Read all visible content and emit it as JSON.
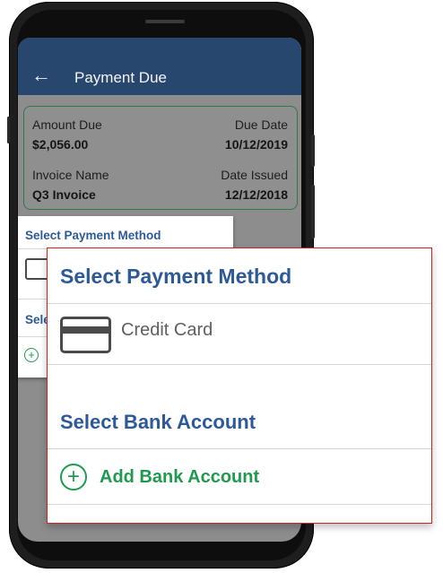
{
  "header": {
    "title": "Payment Due",
    "back_icon": "←"
  },
  "summary": {
    "amount_due_label": "Amount Due",
    "amount_due_value": "$2,056.00",
    "due_date_label": "Due Date",
    "due_date_value": "10/12/2019",
    "invoice_name_label": "Invoice Name",
    "invoice_name_value": "Q3 Invoice",
    "date_issued_label": "Date Issued",
    "date_issued_value": "12/12/2018"
  },
  "sheet": {
    "payment_method_title": "Select Payment Method",
    "bank_account_title_partial": "Sele",
    "plus_glyph": "+"
  },
  "zoom_panel": {
    "payment_method_title": "Select Payment Method",
    "credit_card_label": "Credit Card",
    "bank_account_title": "Select Bank Account",
    "add_bank_account_label": "Add Bank Account",
    "plus_glyph": "+"
  },
  "colors": {
    "app_bar": "#28476e",
    "section_title": "#2d5a97",
    "action_green": "#1f9a4f",
    "highlight_border": "#d62020"
  },
  "icons": [
    "back-arrow-icon",
    "credit-card-icon",
    "add-circle-icon"
  ]
}
